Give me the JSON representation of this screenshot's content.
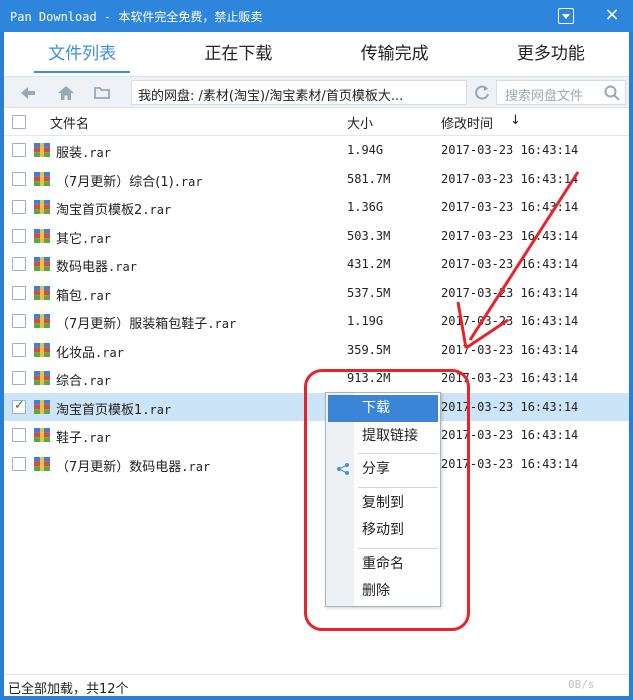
{
  "window": {
    "title": "Pan Download - 本软件完全免费，禁止贩卖",
    "colors": {
      "titlebar": "#2e86dc",
      "accent": "#3b8fe0",
      "selected_row": "#cce4f7",
      "menu_highlight": "#3a85d8",
      "annotation": "#e8232b"
    }
  },
  "tabs": [
    {
      "label": "文件列表",
      "active": true
    },
    {
      "label": "正在下载",
      "active": false
    },
    {
      "label": "传输完成",
      "active": false
    },
    {
      "label": "更多功能",
      "active": false
    }
  ],
  "toolbar": {
    "path_label": "我的网盘:",
    "path_value": "/素材(淘宝)/淘宝素材/首页模板大...",
    "search_placeholder": "搜索网盘文件"
  },
  "table": {
    "columns": {
      "name": "文件名",
      "size": "大小",
      "modified": "修改时间",
      "sort_indicator": "↓"
    },
    "rows": [
      {
        "name": "服装",
        "ext": ".rar",
        "size": "1.94G",
        "modified": "2017-03-23 16:43:14",
        "checked": false
      },
      {
        "name": "（7月更新）综合(1)",
        "ext": ".rar",
        "size": "581.7M",
        "modified": "2017-03-23 16:43:14",
        "checked": false
      },
      {
        "name": "淘宝首页模板2",
        "ext": ".rar",
        "size": "1.36G",
        "modified": "2017-03-23 16:43:14",
        "checked": false
      },
      {
        "name": "其它",
        "ext": ".rar",
        "size": "503.3M",
        "modified": "2017-03-23 16:43:14",
        "checked": false
      },
      {
        "name": "数码电器",
        "ext": ".rar",
        "size": "431.2M",
        "modified": "2017-03-23 16:43:14",
        "checked": false
      },
      {
        "name": "箱包",
        "ext": ".rar",
        "size": "537.5M",
        "modified": "2017-03-23 16:43:14",
        "checked": false
      },
      {
        "name": "（7月更新）服装箱包鞋子",
        "ext": ".rar",
        "size": "1.19G",
        "modified": "2017-03-23 16:43:14",
        "checked": false
      },
      {
        "name": "化妆品",
        "ext": ".rar",
        "size": "359.5M",
        "modified": "2017-03-23 16:43:14",
        "checked": false
      },
      {
        "name": "综合",
        "ext": ".rar",
        "size": "913.2M",
        "modified": "2017-03-23 16:43:14",
        "checked": false
      },
      {
        "name": "淘宝首页模板1",
        "ext": ".rar",
        "size": "",
        "modified": "2017-03-23 16:43:14",
        "checked": true
      },
      {
        "name": "鞋子",
        "ext": ".rar",
        "size": "",
        "modified": "2017-03-23 16:43:14",
        "checked": false
      },
      {
        "name": "（7月更新）数码电器",
        "ext": ".rar",
        "size": "",
        "modified": "2017-03-23 16:43:14",
        "checked": false
      }
    ]
  },
  "context_menu": {
    "download": "下载",
    "copy_link": "提取链接",
    "share": "分享",
    "copy_to": "复制到",
    "move_to": "移动到",
    "rename": "重命名",
    "delete": "删除"
  },
  "status": {
    "text": "已全部加载，共12个",
    "speed": "0B/s"
  }
}
